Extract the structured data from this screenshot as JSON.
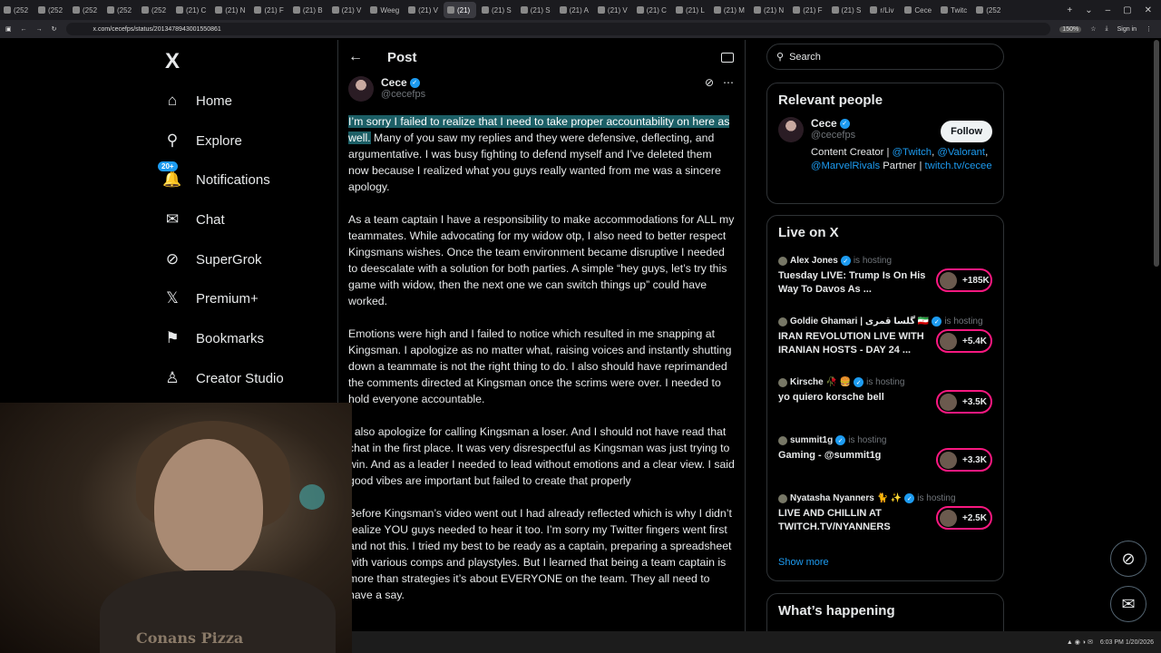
{
  "browser": {
    "tabs": [
      "(252",
      "(252",
      "(252",
      "(252",
      "(252",
      "(21) C",
      "(21) N",
      "(21) F",
      "(21) B",
      "(21) V",
      "Weeg",
      "(21) V",
      "(21)",
      "(21) S",
      "(21) S",
      "(21) A",
      "(21) V",
      "(21) C",
      "(21) L",
      "(21) M",
      "(21) N",
      "(21) F",
      "(21) S",
      "r/Liv",
      "Cece",
      "Twitc",
      "(252"
    ],
    "active_tab_index": 12,
    "url": "x.com/cecefps/status/2013478943001550861",
    "zoom": "150%",
    "sign_in": "Sign in"
  },
  "nav": {
    "logo": "X",
    "items": [
      {
        "label": "Home",
        "icon": "home-icon",
        "glyph": "⌂"
      },
      {
        "label": "Explore",
        "icon": "search-icon",
        "glyph": "⚲"
      },
      {
        "label": "Notifications",
        "icon": "bell-icon",
        "glyph": "🔔"
      },
      {
        "label": "Chat",
        "icon": "mail-icon",
        "glyph": "✉"
      },
      {
        "label": "SuperGrok",
        "icon": "grok-icon",
        "glyph": "⊘"
      },
      {
        "label": "Premium+",
        "icon": "x-premium-icon",
        "glyph": "𝕏"
      },
      {
        "label": "Bookmarks",
        "icon": "bookmark-icon",
        "glyph": "⚑"
      },
      {
        "label": "Creator Studio",
        "icon": "creator-studio-icon",
        "glyph": "♙"
      }
    ],
    "notification_badge": "20+"
  },
  "post": {
    "header_title": "Post",
    "author_name": "Cece",
    "author_handle": "@cecefps",
    "highlighted_text": "I’m sorry I failed to realize that I need to take proper accountability on here as well.",
    "paragraphs": [
      " Many of you saw my replies and they were defensive, deflecting, and argumentative. I was busy fighting to defend myself and I’ve deleted them now because I realized what you guys really wanted from me was a sincere apology.",
      "As a team captain I have a responsibility to make accommodations for ALL my teammates. While advocating for my widow otp, I also need to better respect Kingsmans wishes. Once the team environment became disruptive I needed to deescalate with a solution for both parties. A simple “hey guys, let’s try this game with widow, then the next one we can switch things up” could have worked.",
      "Emotions were high and I failed to notice which resulted in me snapping at Kingsman. I apologize as no matter what, raising voices and instantly shutting down a teammate is not the right thing to do. I also should have reprimanded the comments directed at Kingsman once the scrims were over. I needed to hold everyone accountable.",
      "I also apologize for calling Kingsman a loser. And I should not have read that chat in the first place. It was very disrespectful as Kingsman was just trying to win. And as a leader I needed to lead without emotions and a clear view. I said good vibes are important but failed to create that properly",
      "Before Kingsman’s video went out I had already reflected which is why I didn’t realize YOU guys needed to hear it too. I’m sorry my Twitter fingers went first and not this. I tried my best to be ready as a captain, preparing a spreadsheet with various comps and playstyles. But I learned that being a team captain is more than strategies it’s about EVERYONE on the team. They all need to have a say."
    ]
  },
  "sidebar": {
    "search_placeholder": "Search",
    "relevant_title": "Relevant people",
    "relevant": {
      "name": "Cece",
      "handle": "@cecefps",
      "follow_label": "Follow",
      "bio_prefix": "Content Creator | ",
      "bio_link1": "@Twitch",
      "bio_sep1": ", ",
      "bio_link2": "@Valorant",
      "bio_sep2": ", ",
      "bio_link3": "@MarvelRivals",
      "bio_mid": " Partner | ",
      "bio_link4": "twitch.tv/cecee"
    },
    "live_title": "Live on X",
    "hosting_label": "is hosting",
    "live": [
      {
        "host": "Alex Jones",
        "title": "Tuesday LIVE: Trump Is On His Way To Davos As ...",
        "count": "+185K"
      },
      {
        "host": "Goldie Ghamari | گلسا قمری 🇮🇷",
        "title": "IRAN REVOLUTION LIVE WITH IRANIAN HOSTS - DAY 24 ...",
        "count": "+5.4K"
      },
      {
        "host": "Kirsche 🥀 🍔",
        "title": "yo quiero korsche bell",
        "count": "+3.5K"
      },
      {
        "host": "summit1g",
        "title": "Gaming - @summit1g",
        "count": "+3.3K"
      },
      {
        "host": "Nyatasha Nyanners 🐈 ✨",
        "title": "LIVE AND CHILLIN AT TWITCH.TV/NYANNERS",
        "count": "+2.5K"
      }
    ],
    "show_more": "Show more",
    "happening_title": "What’s happening"
  },
  "webcam": {
    "shirt_text": "Conans Pizza"
  },
  "taskbar": {
    "time": "6:03 PM",
    "date": "1/20/2026"
  }
}
